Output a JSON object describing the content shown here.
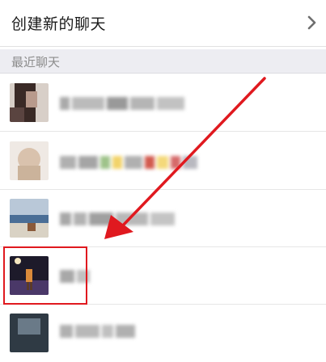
{
  "header": {
    "create_label": "创建新的聊天"
  },
  "recent": {
    "section_label": "最近聊天",
    "chats": [
      {
        "name": "",
        "avatar": "avatar-1"
      },
      {
        "name": "",
        "avatar": "avatar-2"
      },
      {
        "name": "",
        "avatar": "avatar-3"
      },
      {
        "name": "",
        "avatar": "avatar-4"
      },
      {
        "name": "",
        "avatar": "avatar-5"
      }
    ]
  },
  "annotation": {
    "arrow_color": "#e0191f",
    "box_color": "#e0191f"
  },
  "icons": {
    "chevron": "chevron-right-icon"
  }
}
